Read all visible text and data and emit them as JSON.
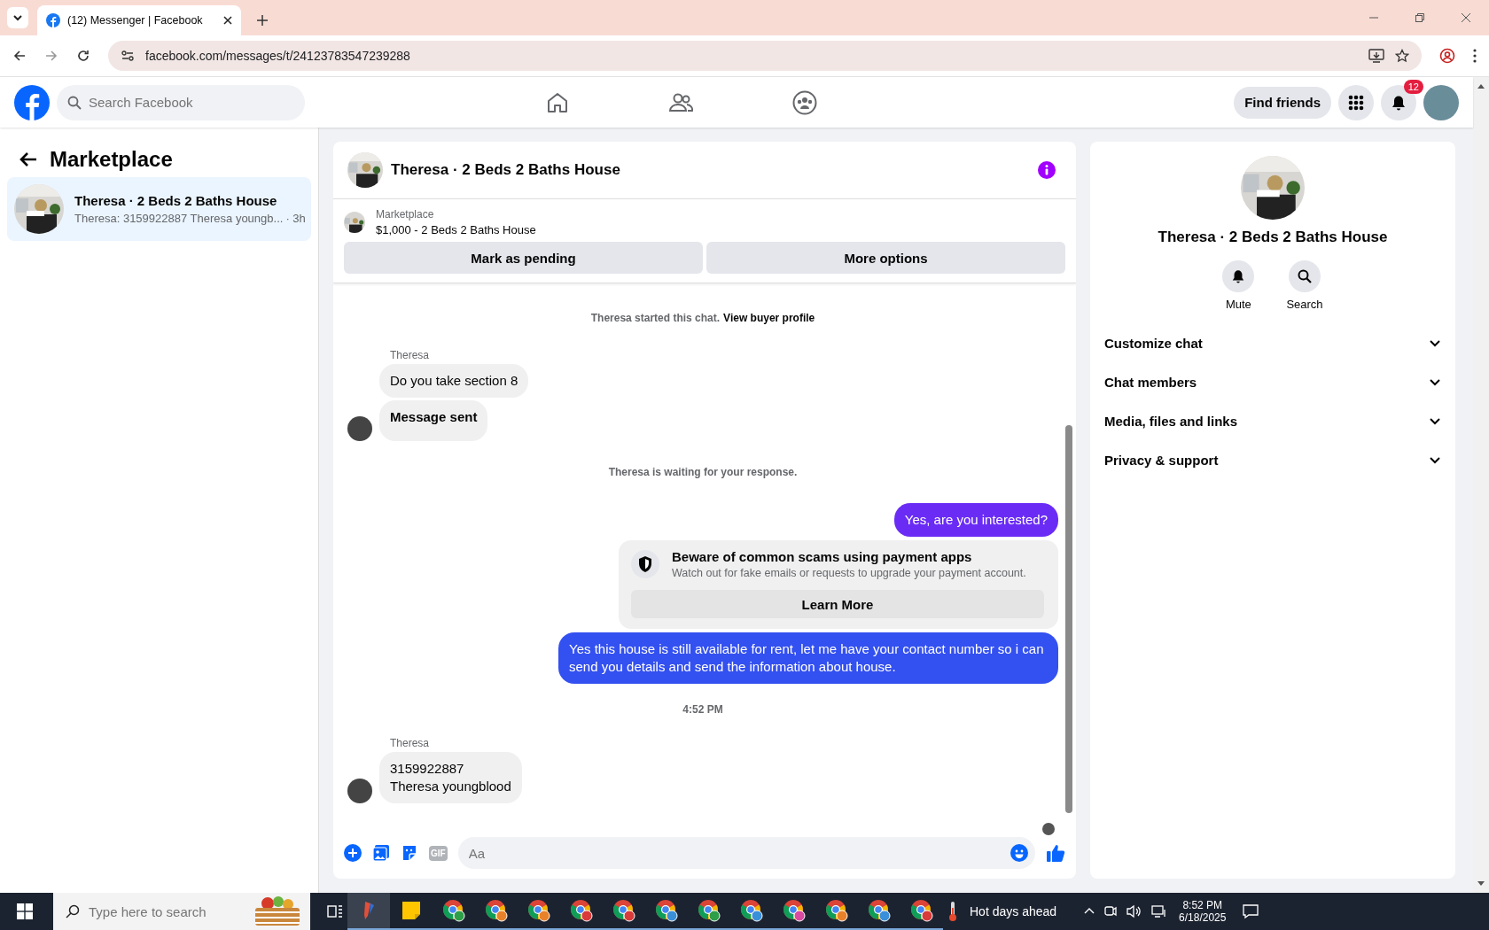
{
  "browser": {
    "tab_title": "(12) Messenger | Facebook",
    "url": "facebook.com/messages/t/24123783547239288"
  },
  "header": {
    "search_placeholder": "Search Facebook",
    "find_friends": "Find friends",
    "notification_count": "12"
  },
  "sidebar": {
    "title": "Marketplace",
    "conversations": [
      {
        "title": "Theresa · 2 Beds 2 Baths House",
        "preview": "Theresa: 3159922887 Theresa youngb...",
        "time": "· 3h",
        "selected": true
      }
    ]
  },
  "chat": {
    "title": "Theresa · 2 Beds 2 Baths House",
    "listing": {
      "label": "Marketplace",
      "name": "$1,000 - 2 Beds 2 Baths House"
    },
    "buttons": [
      "Mark as pending",
      "More options"
    ],
    "messages": [
      {
        "kind": "system",
        "text": "Theresa started this chat.",
        "link": "View buyer profile"
      },
      {
        "kind": "incoming",
        "sender": "Theresa",
        "bubbles": [
          {
            "lines": [
              "Do you take section 8"
            ],
            "bold": false
          },
          {
            "lines": [
              "Message sent"
            ],
            "bold": true
          }
        ]
      },
      {
        "kind": "system",
        "text": "Theresa is waiting for your response."
      },
      {
        "kind": "outgoing",
        "text": "Yes, are you interested?",
        "color": "#6a2cf5"
      },
      {
        "kind": "notice",
        "title": "Beware of common scams using payment apps",
        "body": "Watch out for fake emails or requests to upgrade your payment account.",
        "button": "Learn More"
      },
      {
        "kind": "outgoing",
        "text": "Yes this house is still available for rent, let me have your contact number so i can send you details and send the information about house.",
        "color": "#3350f0"
      },
      {
        "kind": "timestamp",
        "text": "4:52 PM"
      },
      {
        "kind": "incoming",
        "sender": "Theresa",
        "bubbles": [
          {
            "lines": [
              "3159922887",
              "Theresa youngblood"
            ],
            "bold": false
          }
        ]
      }
    ],
    "composer": {
      "gif": "GIF",
      "placeholder": "Aa"
    }
  },
  "details": {
    "title": "Theresa · 2 Beds 2 Baths House",
    "actions": [
      {
        "kind": "bell",
        "label": "Mute"
      },
      {
        "kind": "search",
        "label": "Search"
      }
    ],
    "sections": [
      {
        "label": "Customize chat",
        "expanded": false
      },
      {
        "label": "Chat members",
        "expanded": false
      },
      {
        "label": "Media, files and links",
        "expanded": false
      },
      {
        "label": "Privacy & support",
        "expanded": false
      }
    ]
  },
  "taskbar": {
    "search_placeholder": "Type here to search",
    "apps": [
      {
        "kind": "pen"
      },
      {
        "kind": "notes"
      },
      {
        "kind": "chrome",
        "color": "#2e9e48"
      },
      {
        "kind": "chrome",
        "color": "#e8822a"
      },
      {
        "kind": "chrome",
        "color": "#e8822a"
      },
      {
        "kind": "chrome",
        "color": "#d93a3a"
      },
      {
        "kind": "chrome",
        "color": "#d93a3a"
      },
      {
        "kind": "chrome",
        "color": "#3a8fd9"
      },
      {
        "kind": "chrome",
        "color": "#2e9e48"
      },
      {
        "kind": "chrome",
        "color": "#3a8fd9"
      },
      {
        "kind": "chrome",
        "color": "#d94aa0"
      },
      {
        "kind": "chrome",
        "color": "#e8822a"
      },
      {
        "kind": "chrome",
        "color": "#3a8fd9"
      },
      {
        "kind": "chrome",
        "color": "#d93a3a"
      }
    ],
    "weather": "Hot days ahead",
    "time": "8:52 PM",
    "date": "6/18/2025"
  }
}
